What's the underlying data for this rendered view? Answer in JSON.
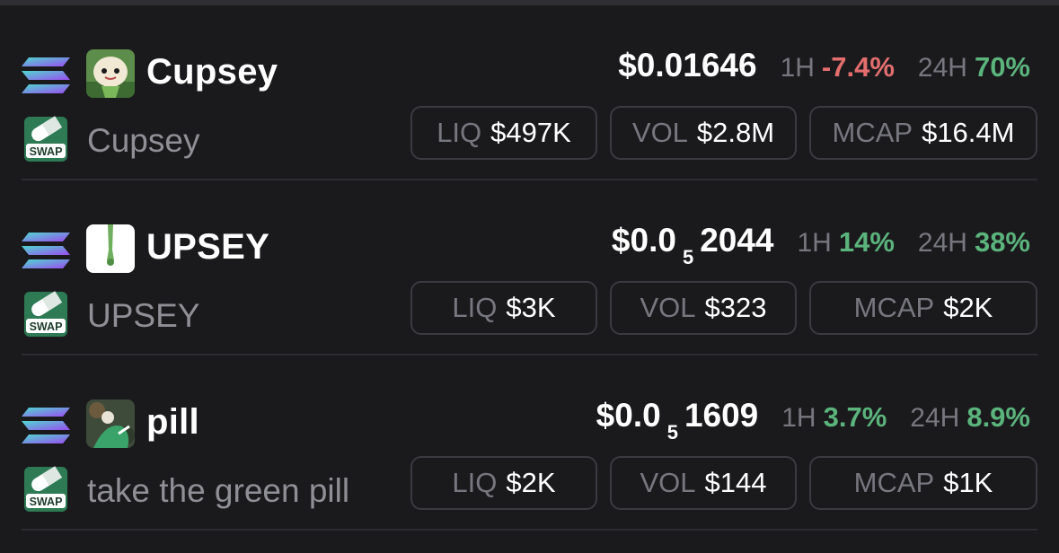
{
  "tokens": [
    {
      "symbol": "Cupsey",
      "name": "Cupsey",
      "price": {
        "main": "$0.01646",
        "sub": "",
        "tail": ""
      },
      "change_1h_label": "1H",
      "change_1h": "-7.4%",
      "change_24h_label": "24H",
      "change_24h": "70%",
      "liq_label": "LIQ",
      "liq": "$497K",
      "vol_label": "VOL",
      "vol": "$2.8M",
      "mcap_label": "MCAP",
      "mcap": "$16.4M"
    },
    {
      "symbol": "UPSEY",
      "name": "UPSEY",
      "price": {
        "main": "$0.0",
        "sub": "5",
        "tail": "2044"
      },
      "change_1h_label": "1H",
      "change_1h": "14%",
      "change_24h_label": "24H",
      "change_24h": "38%",
      "liq_label": "LIQ",
      "liq": "$3K",
      "vol_label": "VOL",
      "vol": "$323",
      "mcap_label": "MCAP",
      "mcap": "$2K"
    },
    {
      "symbol": "pill",
      "name": "take the green pill",
      "price": {
        "main": "$0.0",
        "sub": "5",
        "tail": "1609"
      },
      "change_1h_label": "1H",
      "change_1h": "3.7%",
      "change_24h_label": "24H",
      "change_24h": "8.9%",
      "liq_label": "LIQ",
      "liq": "$2K",
      "vol_label": "VOL",
      "vol": "$144",
      "mcap_label": "MCAP",
      "mcap": "$1K"
    }
  ],
  "swap_badge_text": "SWAP",
  "icons": {
    "chain": "solana-logo-icon",
    "swap": "swap-pill-icon"
  },
  "colors": {
    "positive": "#5bb47c",
    "negative": "#e46e6e",
    "background": "#1a1a1d"
  }
}
